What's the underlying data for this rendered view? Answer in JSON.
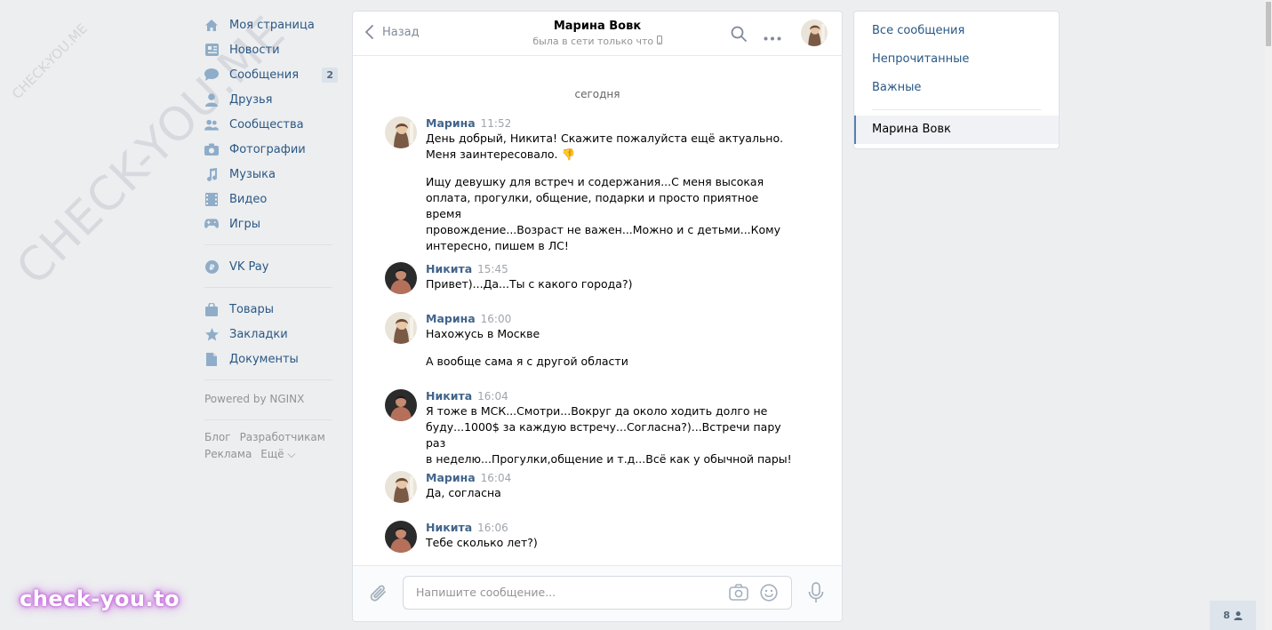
{
  "watermarks": {
    "big": "CHECK-YOU.ME",
    "small": "CHECK-YOU.ME",
    "brand": "check-you.to"
  },
  "nav": {
    "items": [
      {
        "label": "Моя страница",
        "icon": "home-icon"
      },
      {
        "label": "Новости",
        "icon": "news-icon"
      },
      {
        "label": "Сообщения",
        "icon": "message-icon",
        "badge": "2"
      },
      {
        "label": "Друзья",
        "icon": "friend-icon"
      },
      {
        "label": "Сообщества",
        "icon": "group-icon"
      },
      {
        "label": "Фотографии",
        "icon": "camera-icon"
      },
      {
        "label": "Музыка",
        "icon": "music-icon"
      },
      {
        "label": "Видео",
        "icon": "video-icon"
      },
      {
        "label": "Игры",
        "icon": "gamepad-icon"
      }
    ],
    "vkpay": "VK Pay",
    "extra": [
      "Товары",
      "Закладки",
      "Документы"
    ],
    "powered": "Powered by NGINX",
    "links": [
      "Блог",
      "Разработчикам",
      "Реклама",
      "Ещё ⌵"
    ]
  },
  "chat": {
    "back_label": "Назад",
    "peer_name": "Марина Вовк",
    "peer_status": "была в сети только что",
    "date_separator": "сегодня",
    "messages": [
      {
        "author": "Марина",
        "time": "11:52",
        "who": "marina",
        "texts": [
          "День добрый, Никита! Скажите пожалуйста ещё актуально.\nМеня заинтересовало. 👎",
          "Ищу девушку для встреч и содержания...С меня высокая\nоплата, прогулки, общение, подарки и просто приятное время\nпровождение...Возраст не важен...Можно и с детьми...Кому\nинтересно, пишем в ЛС!"
        ]
      },
      {
        "author": "Никита",
        "time": "15:45",
        "who": "nikita",
        "texts": [
          "Привет)...Да...Ты с какого города?)"
        ]
      },
      {
        "author": "Марина",
        "time": "16:00",
        "who": "marina",
        "texts": [
          "Нахожусь в Москве",
          "А вообще сама я с другой области"
        ]
      },
      {
        "author": "Никита",
        "time": "16:04",
        "who": "nikita",
        "texts": [
          "Я тоже в МСК...Смотри...Вокруг да около ходить долго не\nбуду...1000$ за каждую встречу...Согласна?)...Встречи пару раз\nв неделю...Прогулки,общение и т.д...Всё как у обычной пары!"
        ]
      },
      {
        "author": "Марина",
        "time": "16:04",
        "who": "marina",
        "texts": [
          "Да, согласна"
        ]
      },
      {
        "author": "Никита",
        "time": "16:06",
        "who": "nikita",
        "texts": [
          "Тебе сколько лет?)"
        ]
      }
    ],
    "input_placeholder": "Напишите сообщение..."
  },
  "right": {
    "filters": [
      "Все сообщения",
      "Непрочитанные",
      "Важные"
    ],
    "active": "Марина Вовк"
  },
  "online_count": "8"
}
